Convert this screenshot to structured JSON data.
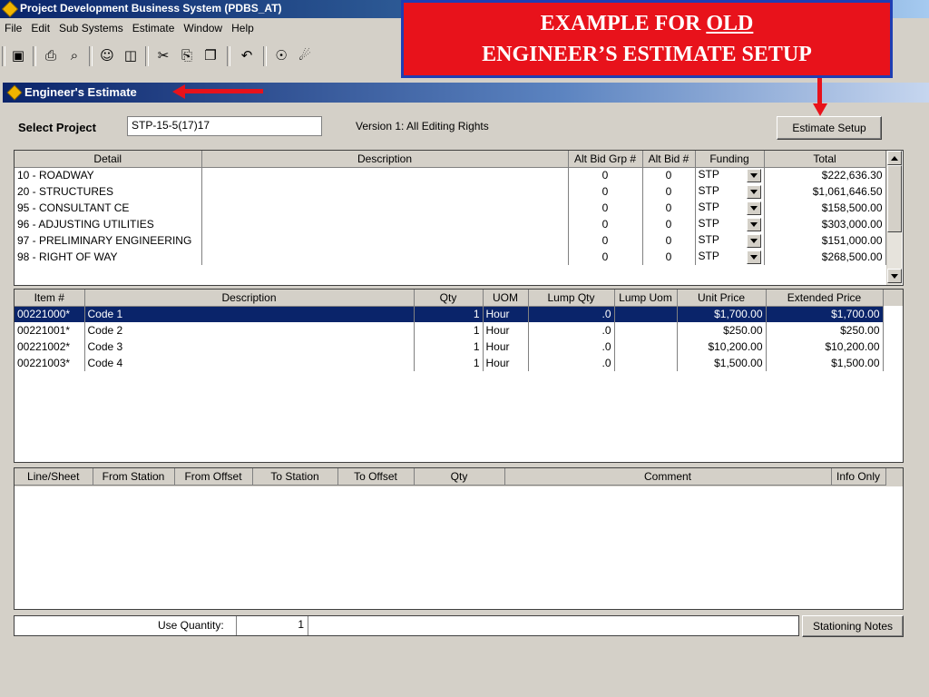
{
  "app": {
    "title": "Project Development Business System (PDBS_AT)"
  },
  "menu": [
    "File",
    "Edit",
    "Sub Systems",
    "Estimate",
    "Window",
    "Help"
  ],
  "toolbar": [
    "save-icon",
    "print-icon",
    "print-preview-icon",
    "person-icon",
    "columns-icon",
    "cut-icon",
    "copy-icon",
    "paste-icon",
    "undo-icon",
    "find-icon",
    "find-replace-icon"
  ],
  "banner": {
    "line1_prefix": "EXAMPLE FOR ",
    "line1_underlined": "OLD",
    "line2": "ENGINEER’S ESTIMATE SETUP"
  },
  "window": {
    "title": "Engineer's Estimate"
  },
  "project": {
    "label": "Select Project",
    "value": "STP-15-5(17)17",
    "version": "Version 1: All Editing Rights",
    "setup_button": "Estimate Setup"
  },
  "groups": {
    "headers": [
      "Detail",
      "Description",
      "Alt Bid Grp #",
      "Alt Bid #",
      "Funding",
      "Total"
    ],
    "rows": [
      {
        "detail": "10 - ROADWAY",
        "description": "",
        "alt_grp": "0",
        "alt_bid": "0",
        "funding": "STP",
        "total": "$222,636.30"
      },
      {
        "detail": "20 - STRUCTURES",
        "description": "",
        "alt_grp": "0",
        "alt_bid": "0",
        "funding": "STP",
        "total": "$1,061,646.50"
      },
      {
        "detail": "95 - CONSULTANT CE",
        "description": "",
        "alt_grp": "0",
        "alt_bid": "0",
        "funding": "STP",
        "total": "$158,500.00"
      },
      {
        "detail": "96 - ADJUSTING UTILITIES",
        "description": "",
        "alt_grp": "0",
        "alt_bid": "0",
        "funding": "STP",
        "total": "$303,000.00"
      },
      {
        "detail": "97 - PRELIMINARY ENGINEERING",
        "description": "",
        "alt_grp": "0",
        "alt_bid": "0",
        "funding": "STP",
        "total": "$151,000.00"
      },
      {
        "detail": "98 - RIGHT OF WAY",
        "description": "",
        "alt_grp": "0",
        "alt_bid": "0",
        "funding": "STP",
        "total": "$268,500.00"
      }
    ]
  },
  "items": {
    "headers": [
      "Item #",
      "Description",
      "Qty",
      "UOM",
      "Lump Qty",
      "Lump Uom",
      "Unit Price",
      "Extended Price"
    ],
    "rows": [
      {
        "item": "00221000*",
        "description": "Code 1",
        "qty": "1",
        "uom": "Hour",
        "lump_qty": ".0",
        "lump_uom": "",
        "unit_price": "$1,700.00",
        "extended": "$1,700.00"
      },
      {
        "item": "00221001*",
        "description": "Code 2",
        "qty": "1",
        "uom": "Hour",
        "lump_qty": ".0",
        "lump_uom": "",
        "unit_price": "$250.00",
        "extended": "$250.00"
      },
      {
        "item": "00221002*",
        "description": "Code 3",
        "qty": "1",
        "uom": "Hour",
        "lump_qty": ".0",
        "lump_uom": "",
        "unit_price": "$10,200.00",
        "extended": "$10,200.00"
      },
      {
        "item": "00221003*",
        "description": "Code 4",
        "qty": "1",
        "uom": "Hour",
        "lump_qty": ".0",
        "lump_uom": "",
        "unit_price": "$1,500.00",
        "extended": "$1,500.00"
      }
    ]
  },
  "stations": {
    "headers": [
      "Line/Sheet",
      "From Station",
      "From Offset",
      "To Station",
      "To Offset",
      "Qty",
      "Comment",
      "Info Only"
    ]
  },
  "footer": {
    "use_quantity_label": "Use Quantity:",
    "use_quantity_value": "1",
    "stationing_button": "Stationing Notes"
  },
  "colors": {
    "banner_red": "#e8121b",
    "banner_border": "#1e3eb4",
    "selection": "#0a246a",
    "titlebar": "#0a246a"
  }
}
